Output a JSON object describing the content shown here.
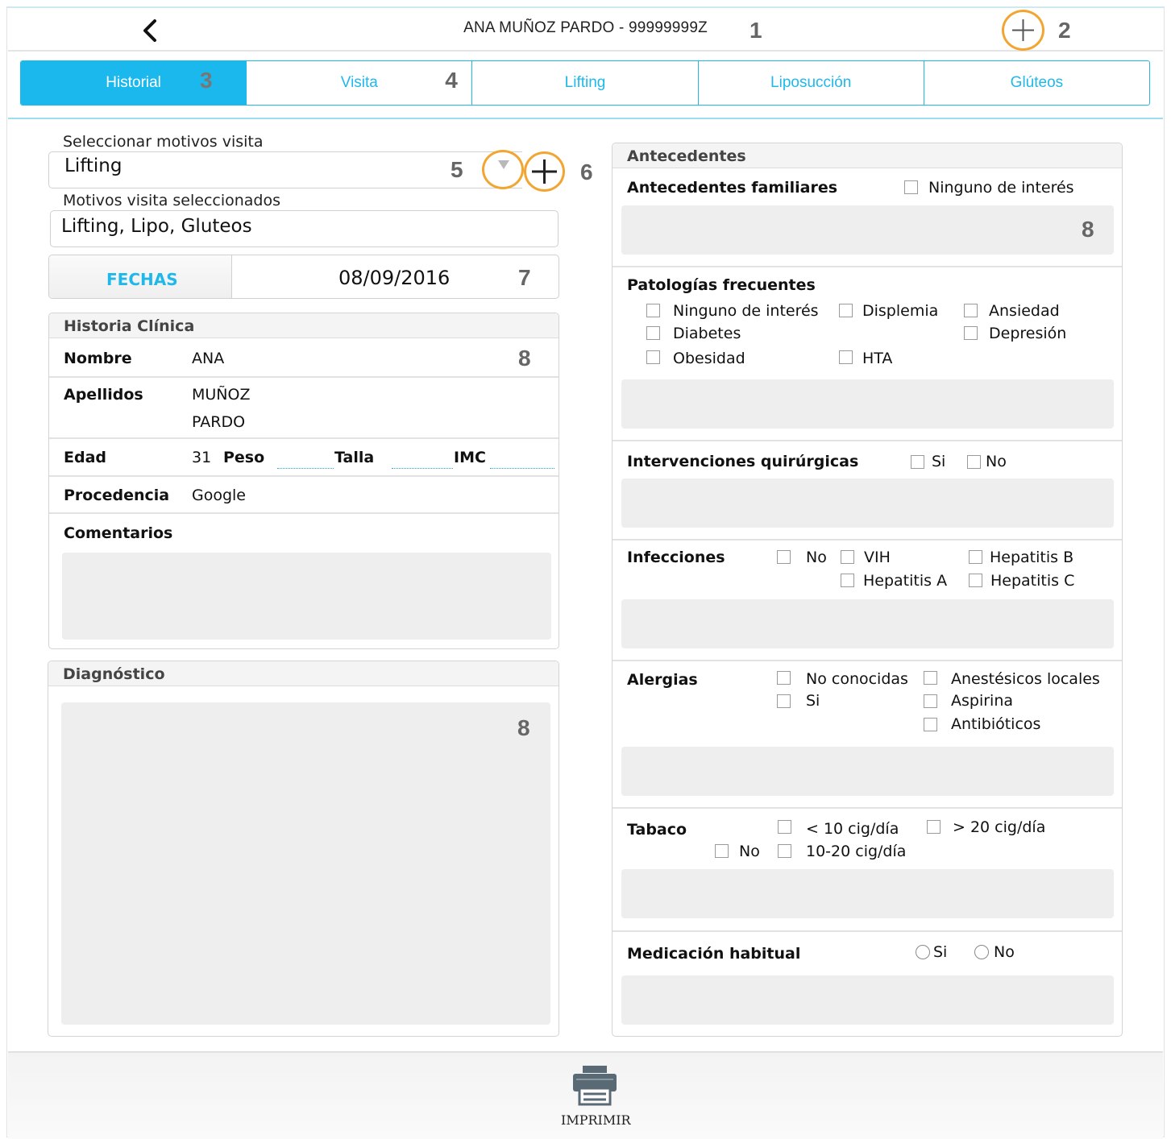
{
  "header": {
    "title": "ANA MUÑOZ PARDO - 99999999Z"
  },
  "markers": {
    "m1": "1",
    "m2": "2",
    "m3": "3",
    "m4": "4",
    "m5": "5",
    "m6": "6",
    "m7": "7",
    "m8": "8"
  },
  "tabs": [
    {
      "label": "Historial",
      "active": true
    },
    {
      "label": "Visita"
    },
    {
      "label": "Lifting"
    },
    {
      "label": "Liposucción"
    },
    {
      "label": "Glúteos"
    }
  ],
  "visit": {
    "select_label": "Seleccionar motivos visita",
    "select_value": "Lifting",
    "selected_label": "Motivos visita seleccionados",
    "selected_value": "Lifting, Lipo, Gluteos"
  },
  "dates": {
    "button": "FECHAS",
    "value": "08/09/2016"
  },
  "historia": {
    "title": "Historia Clínica",
    "nombre_label": "Nombre",
    "nombre": "ANA",
    "apellidos_label": "Apellidos",
    "apellido1": "MUÑOZ",
    "apellido2": "PARDO",
    "edad_label": "Edad",
    "edad": "31",
    "peso_label": "Peso",
    "talla_label": "Talla",
    "imc_label": "IMC",
    "procedencia_label": "Procedencia",
    "procedencia": "Google",
    "comentarios_label": "Comentarios"
  },
  "diagnostico": {
    "title": "Diagnóstico"
  },
  "antecedentes": {
    "title": "Antecedentes",
    "familiares": {
      "label": "Antecedentes familiares",
      "ninguno": "Ninguno de interés"
    },
    "patologias": {
      "label": "Patologías frecuentes",
      "ninguno": "Ninguno de interés",
      "displemia": "Displemia",
      "ansiedad": "Ansiedad",
      "diabetes": "Diabetes",
      "depresion": "Depresión",
      "obesidad": "Obesidad",
      "hta": "HTA"
    },
    "intervenciones": {
      "label": "Intervenciones quirúrgicas",
      "si": "Si",
      "no": "No"
    },
    "infecciones": {
      "label": "Infecciones",
      "no": "No",
      "vih": "VIH",
      "hepb": "Hepatitis B",
      "hepa": "Hepatitis A",
      "hepc": "Hepatitis C"
    },
    "alergias": {
      "label": "Alergias",
      "noconocidas": "No conocidas",
      "si": "Si",
      "anestesicos": "Anestésicos locales",
      "aspirina": "Aspirina",
      "antibioticos": "Antibióticos"
    },
    "tabaco": {
      "label": "Tabaco",
      "menos10": "< 10 cig/día",
      "mas20": "> 20 cig/día",
      "no": "No",
      "10a20": "10-20 cig/día"
    },
    "medicacion": {
      "label": "Medicación habitual",
      "si": "Si",
      "no": "No"
    }
  },
  "footer": {
    "print_label": "IMPRIMIR"
  },
  "colors": {
    "accent": "#1bb8ee",
    "highlight": "#f2a530"
  }
}
